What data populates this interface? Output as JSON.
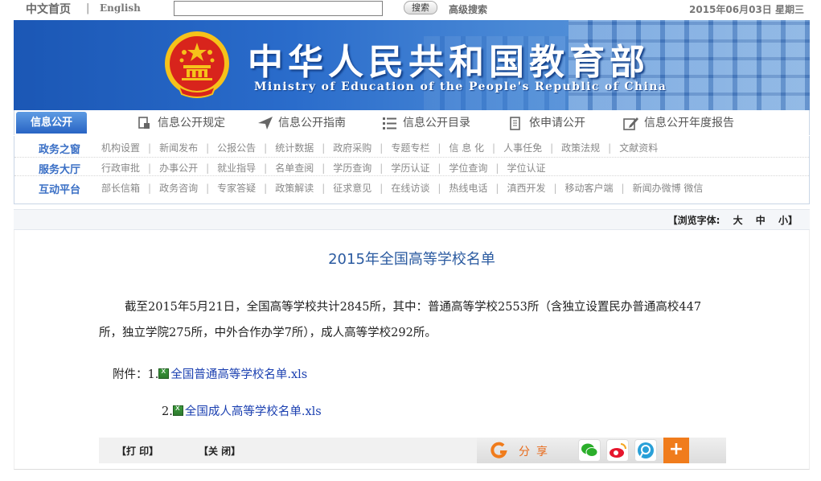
{
  "topbar": {
    "home": "中文首页",
    "sep": "|",
    "english": "English",
    "search_placeholder": "",
    "search_button": "搜索",
    "advanced": "高级搜索",
    "date": "2015年06月03日 星期三"
  },
  "banner": {
    "title_cn": "中华人民共和国教育部",
    "title_en": "Ministry of Education of the People's Republic of China"
  },
  "infonav": {
    "tag": "信息公开",
    "items": [
      {
        "label": "信息公开规定",
        "icon": "document-lock-icon"
      },
      {
        "label": "信息公开指南",
        "icon": "paper-plane-icon"
      },
      {
        "label": "信息公开目录",
        "icon": "list-icon"
      },
      {
        "label": "依申请公开",
        "icon": "notepad-icon"
      },
      {
        "label": "信息公开年度报告",
        "icon": "edit-icon"
      }
    ]
  },
  "categories": [
    {
      "title": "政务之窗",
      "links": [
        "机构设置",
        "新闻发布",
        "公报公告",
        "统计数据",
        "政府采购",
        "专题专栏",
        "信 息 化",
        "人事任免",
        "政策法规",
        "文献资料"
      ]
    },
    {
      "title": "服务大厅",
      "links": [
        "行政审批",
        "办事公开",
        "就业指导",
        "名单查阅",
        "学历查询",
        "学历认证",
        "学位查询",
        "学位认证"
      ]
    },
    {
      "title": "互动平台",
      "links": [
        "部长信箱",
        "政务咨询",
        "专家答疑",
        "政策解读",
        "征求意见",
        "在线访谈",
        "热线电话",
        "滇西开发",
        "移动客户端",
        "新闻办微博 微信"
      ]
    }
  ],
  "fontbar": {
    "label": "【浏览字体:",
    "large": "大",
    "medium": "中",
    "small": "小】"
  },
  "article": {
    "title": "2015年全国高等学校名单",
    "paragraph": "截至2015年5月21日，全国高等学校共计2845所，其中：普通高等学校2553所（含独立设置民办普通高校447所，独立学院275所，中外合作办学7所），成人高等学校292所。",
    "attach_label": "附件：",
    "attachments": [
      {
        "num": "1.",
        "name": "全国普通高等学校名单.xls"
      },
      {
        "num": "2.",
        "name": "全国成人高等学校名单.xls"
      }
    ]
  },
  "bottombar": {
    "print": "【打 印】",
    "close": "【关 闭】",
    "share": "分享",
    "plus": "+"
  },
  "colors": {
    "banner_blue": "#2a6ccb",
    "category_title": "#3a6fc5",
    "article_title": "#2a5aa0",
    "share_orange": "#f07c1c"
  }
}
